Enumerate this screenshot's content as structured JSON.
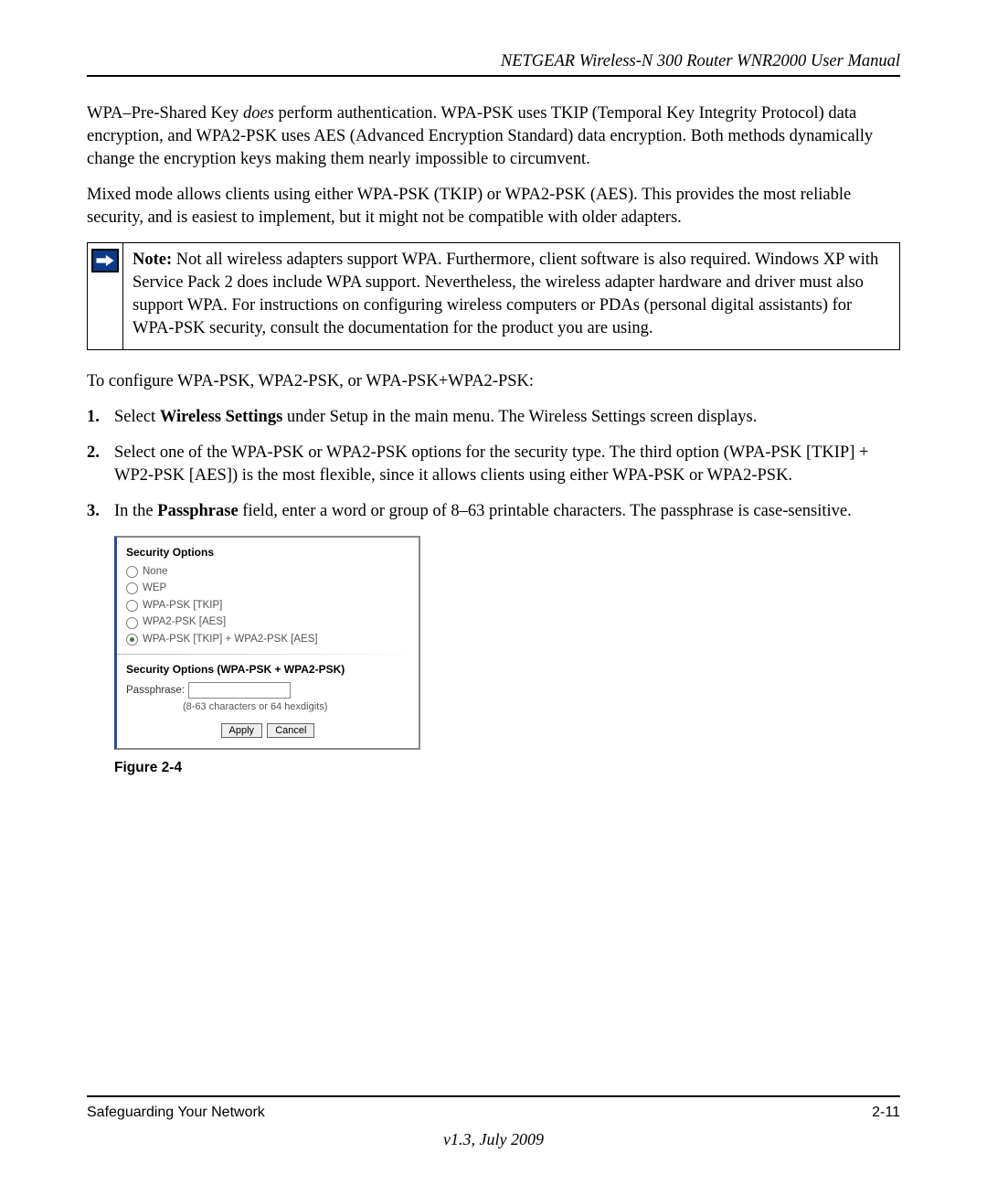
{
  "header": {
    "title": "NETGEAR Wireless-N 300 Router WNR2000 User Manual"
  },
  "paragraphs": {
    "p1_prefix": "WPA–Pre-Shared Key ",
    "p1_italic": "does",
    "p1_suffix": " perform authentication. WPA-PSK uses TKIP (Temporal Key Integrity Protocol) data encryption, and WPA2-PSK uses AES (Advanced Encryption Standard) data encryption. Both methods dynamically change the encryption keys making them nearly impossible to circumvent.",
    "p2": "Mixed mode allows clients using either WPA-PSK (TKIP) or WPA2-PSK (AES). This provides the most reliable security, and is easiest to implement, but it might not be compatible with older adapters."
  },
  "note": {
    "label": "Note:",
    "text": " Not all wireless adapters support WPA. Furthermore, client software is also required. Windows XP with Service Pack 2 does include WPA support. Nevertheless, the wireless adapter hardware and driver must also support WPA. For instructions on configuring wireless computers or PDAs (personal digital assistants) for WPA-PSK security, consult the documentation for the product you are using."
  },
  "before_steps": "To configure WPA-PSK, WPA2-PSK, or WPA-PSK+WPA2-PSK:",
  "steps": [
    {
      "num": "1.",
      "prefix": "Select ",
      "bold": "Wireless Settings",
      "suffix": " under Setup in the main menu. The Wireless Settings screen displays."
    },
    {
      "num": "2.",
      "text": "Select one of the WPA-PSK or WPA2-PSK options for the security type. The third option (WPA-PSK [TKIP] + WP2-PSK [AES]) is the most flexible, since it allows clients using either WPA-PSK or WPA2-PSK."
    },
    {
      "num": "3.",
      "prefix": "In the ",
      "bold": "Passphrase",
      "suffix": " field, enter a word or group of 8–63 printable characters. The passphrase is case-sensitive."
    }
  ],
  "security_panel": {
    "title1": "Security Options",
    "options": [
      {
        "label": "None",
        "checked": false
      },
      {
        "label": "WEP",
        "checked": false
      },
      {
        "label": "WPA-PSK [TKIP]",
        "checked": false
      },
      {
        "label": "WPA2-PSK [AES]",
        "checked": false
      },
      {
        "label": "WPA-PSK [TKIP] + WPA2-PSK [AES]",
        "checked": true
      }
    ],
    "title2": "Security Options (WPA-PSK + WPA2-PSK)",
    "pass_label": "Passphrase:",
    "pass_hint": "(8-63 characters or 64 hexdigits)",
    "apply": "Apply",
    "cancel": "Cancel"
  },
  "figure_caption": "Figure 2-4",
  "footer": {
    "section": "Safeguarding Your Network",
    "page": "2-11",
    "version": "v1.3, July 2009"
  }
}
